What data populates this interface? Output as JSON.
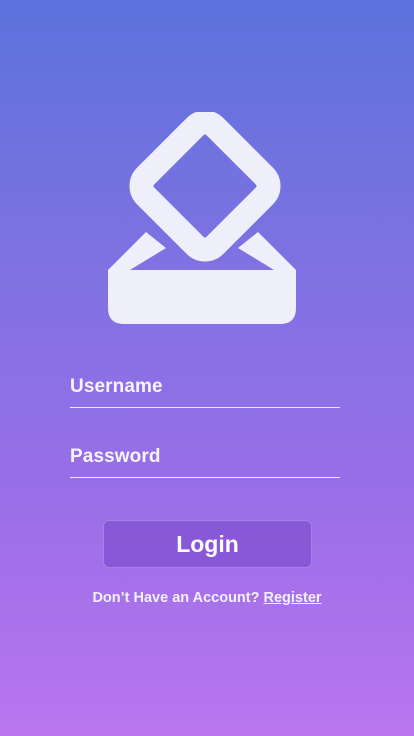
{
  "logo": {
    "icon": "inbox-tray-icon"
  },
  "form": {
    "username_label": "Username",
    "password_label": "Password"
  },
  "actions": {
    "login_label": "Login"
  },
  "footer": {
    "prompt": "Don’t Have an Account?",
    "register_label": "Register"
  }
}
